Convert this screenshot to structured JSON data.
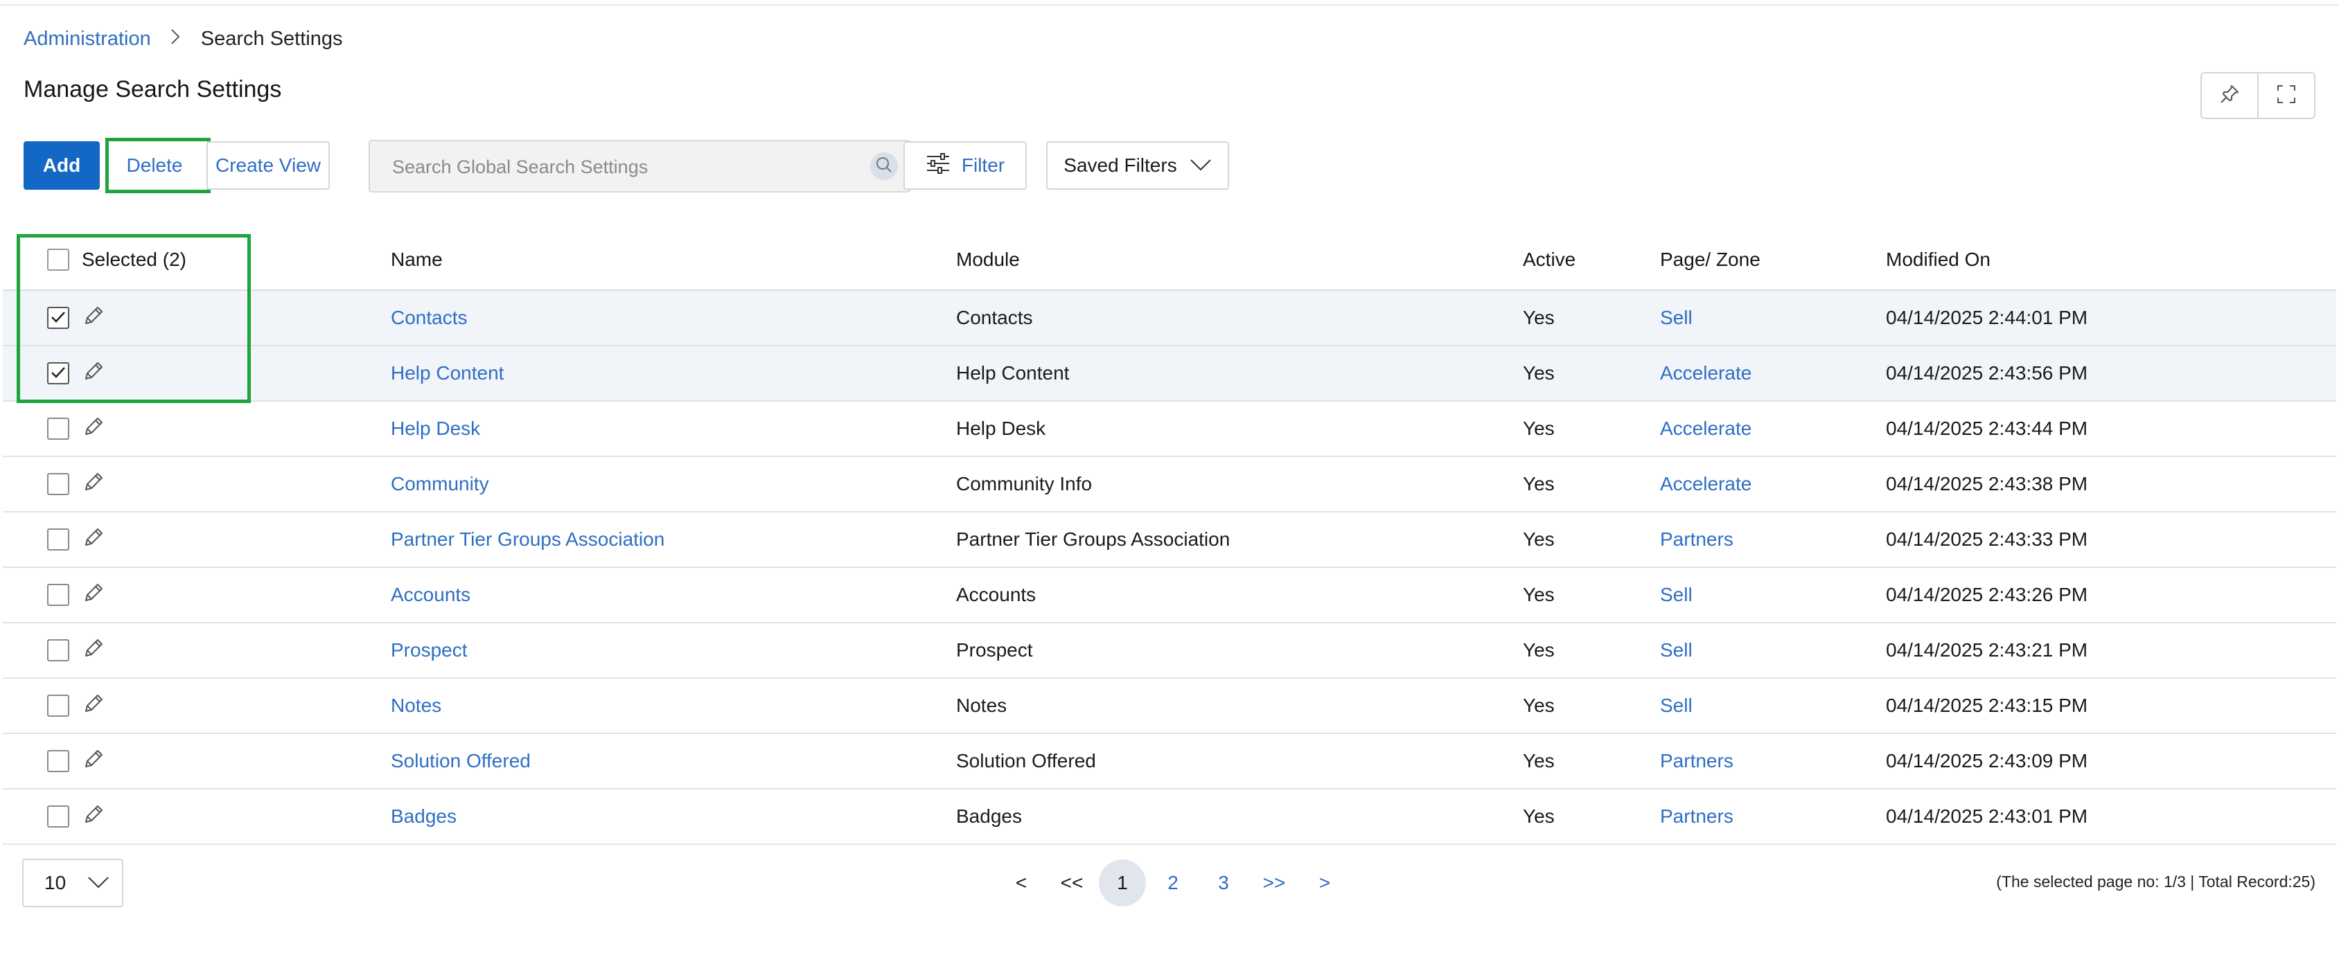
{
  "breadcrumb": {
    "root": "Administration",
    "current": "Search Settings"
  },
  "page": {
    "title": "Manage Search Settings"
  },
  "toolbar": {
    "add_label": "Add",
    "delete_label": "Delete",
    "create_view_label": "Create View",
    "search_placeholder": "Search Global Search Settings",
    "filter_label": "Filter",
    "saved_filters_label": "Saved Filters"
  },
  "table": {
    "selected_label": "Selected (2)",
    "columns": {
      "name": "Name",
      "module": "Module",
      "active": "Active",
      "zone": "Page/ Zone",
      "modified": "Modified On"
    },
    "rows": [
      {
        "name": "Contacts",
        "module": "Contacts",
        "active": "Yes",
        "zone": "Sell",
        "modified": "04/14/2025 2:44:01 PM",
        "selected": true
      },
      {
        "name": "Help Content",
        "module": "Help Content",
        "active": "Yes",
        "zone": "Accelerate",
        "modified": "04/14/2025 2:43:56 PM",
        "selected": true
      },
      {
        "name": "Help Desk",
        "module": "Help Desk",
        "active": "Yes",
        "zone": "Accelerate",
        "modified": "04/14/2025 2:43:44 PM",
        "selected": false
      },
      {
        "name": "Community",
        "module": "Community Info",
        "active": "Yes",
        "zone": "Accelerate",
        "modified": "04/14/2025 2:43:38 PM",
        "selected": false
      },
      {
        "name": "Partner Tier Groups Association",
        "module": "Partner Tier Groups Association",
        "active": "Yes",
        "zone": "Partners",
        "modified": "04/14/2025 2:43:33 PM",
        "selected": false
      },
      {
        "name": "Accounts",
        "module": "Accounts",
        "active": "Yes",
        "zone": "Sell",
        "modified": "04/14/2025 2:43:26 PM",
        "selected": false
      },
      {
        "name": "Prospect",
        "module": "Prospect",
        "active": "Yes",
        "zone": "Sell",
        "modified": "04/14/2025 2:43:21 PM",
        "selected": false
      },
      {
        "name": "Notes",
        "module": "Notes",
        "active": "Yes",
        "zone": "Sell",
        "modified": "04/14/2025 2:43:15 PM",
        "selected": false
      },
      {
        "name": "Solution Offered",
        "module": "Solution Offered",
        "active": "Yes",
        "zone": "Partners",
        "modified": "04/14/2025 2:43:09 PM",
        "selected": false
      },
      {
        "name": "Badges",
        "module": "Badges",
        "active": "Yes",
        "zone": "Partners",
        "modified": "04/14/2025 2:43:01 PM",
        "selected": false
      }
    ]
  },
  "pagination": {
    "page_size": "10",
    "prev": "<",
    "first": "<<",
    "pages": [
      "1",
      "2",
      "3"
    ],
    "current_page": "1",
    "last": ">>",
    "next": ">",
    "info": "(The selected page no: 1/3 | Total Record:25)"
  },
  "colors": {
    "primary": "#1268c4",
    "link": "#2f6ec3",
    "highlight": "#1fa33d",
    "selected_row": "#f1f4f9"
  }
}
